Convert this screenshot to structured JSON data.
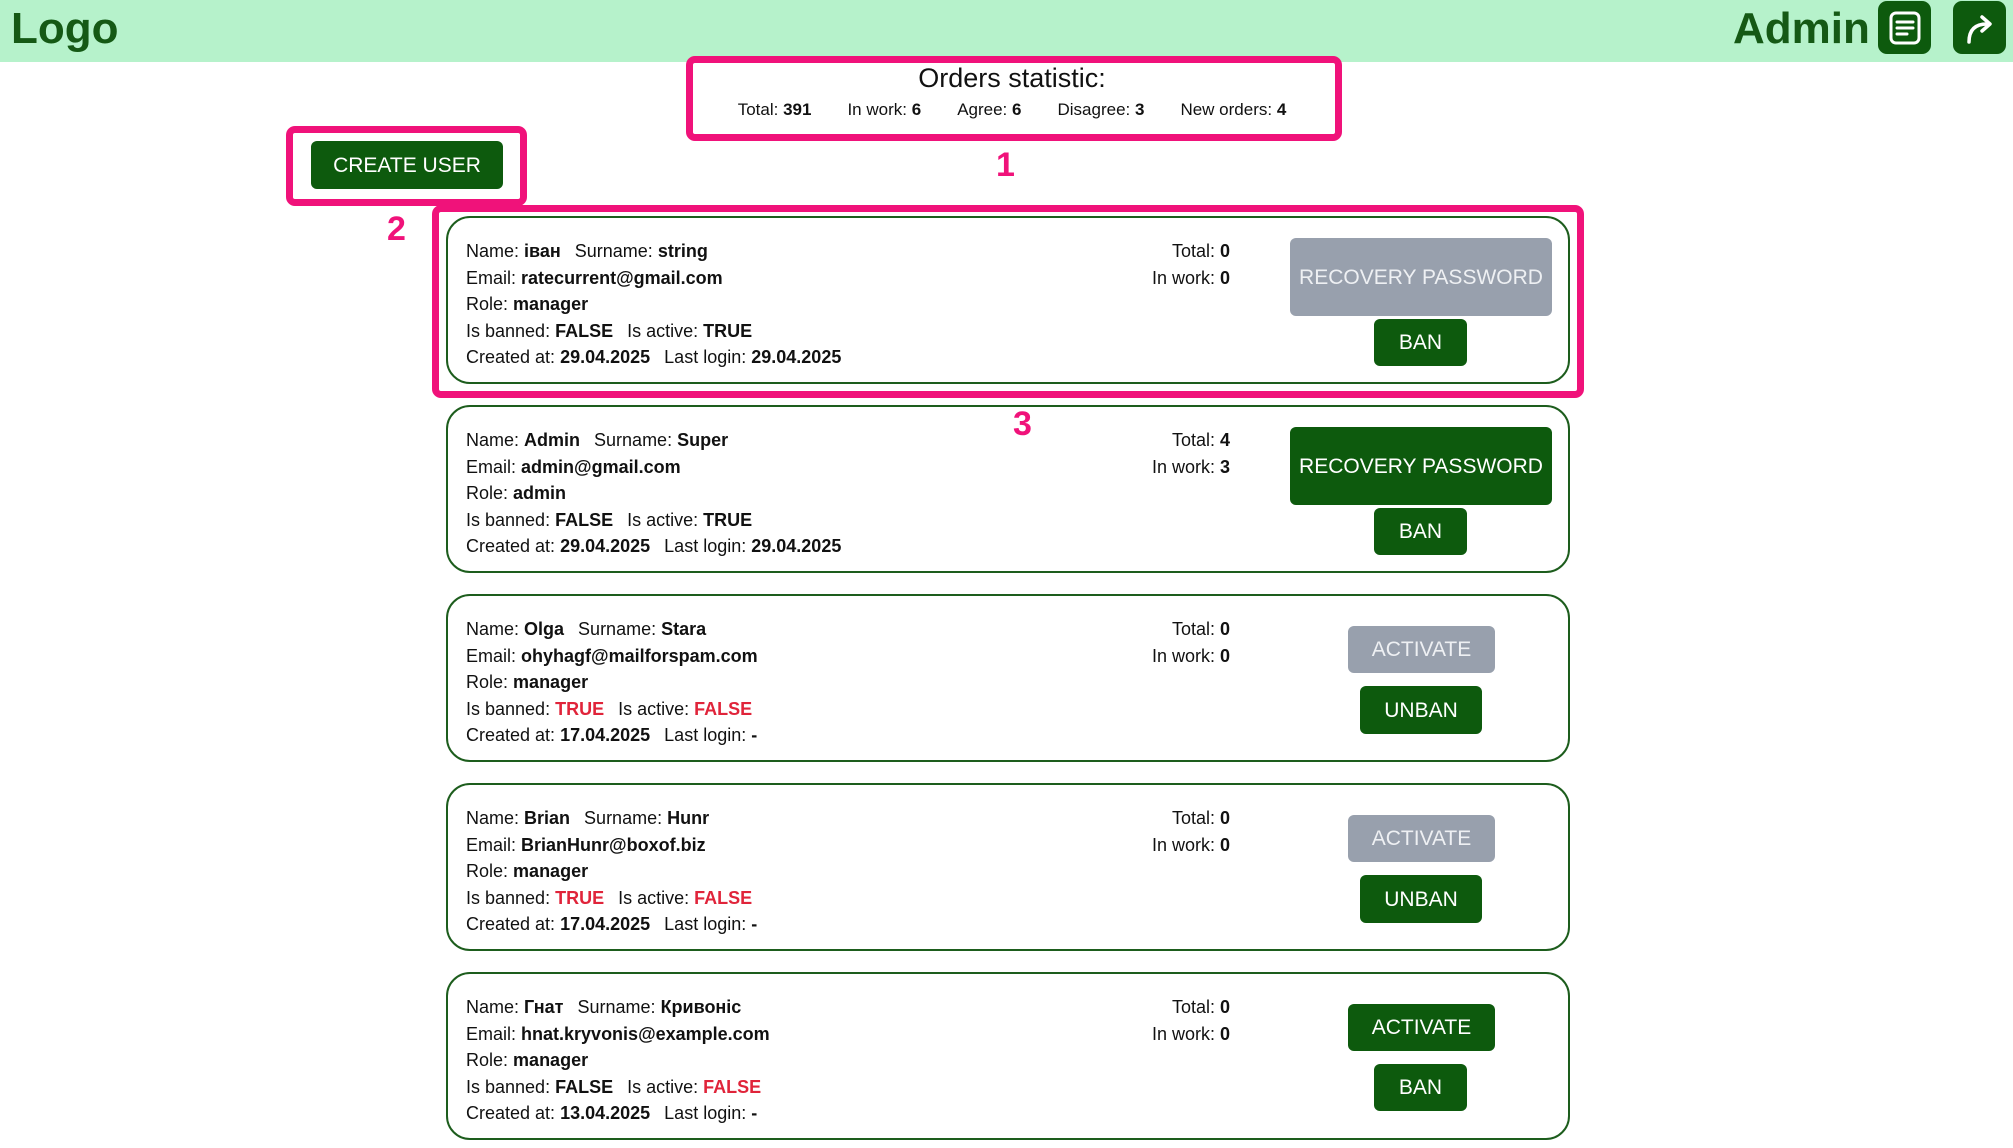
{
  "header": {
    "logo": "Logo",
    "user": "Admin",
    "orders_icon": "document-icon",
    "logout_icon": "share-arrow-icon",
    "bg_color": "#b6f2cb",
    "accent": "#0d5a0d"
  },
  "stats": {
    "title": "Orders statistic:",
    "items": [
      {
        "label": "Total:",
        "value": "391"
      },
      {
        "label": "In work:",
        "value": "6"
      },
      {
        "label": "Agree:",
        "value": "6"
      },
      {
        "label": "Disagree:",
        "value": "3"
      },
      {
        "label": "New orders:",
        "value": "4"
      }
    ]
  },
  "create_user_label": "CREATE USER",
  "annotations": [
    "1",
    "2",
    "3"
  ],
  "labels": {
    "name": "Name:",
    "surname": "Surname:",
    "email": "Email:",
    "role": "Role:",
    "banned": "Is banned:",
    "active": "Is active:",
    "created": "Created at:",
    "last_login": "Last login:",
    "total": "Total:",
    "in_work": "In work:"
  },
  "users": [
    {
      "name": "іван",
      "surname": "string",
      "email": "ratecurrent@gmail.com",
      "role": "manager",
      "banned": "FALSE",
      "active": "TRUE",
      "created": "29.04.2025",
      "last_login": "29.04.2025",
      "total": "0",
      "in_work": "0",
      "primary": "RECOVERY PASSWORD",
      "primary_disabled": true,
      "secondary": "BAN"
    },
    {
      "name": "Admin",
      "surname": "Super",
      "email": "admin@gmail.com",
      "role": "admin",
      "banned": "FALSE",
      "active": "TRUE",
      "created": "29.04.2025",
      "last_login": "29.04.2025",
      "total": "4",
      "in_work": "3",
      "primary": "RECOVERY PASSWORD",
      "primary_disabled": false,
      "secondary": "BAN"
    },
    {
      "name": "Olga",
      "surname": "Stara",
      "email": "ohyhagf@mailforspam.com",
      "role": "manager",
      "banned": "TRUE",
      "active": "FALSE",
      "created": "17.04.2025",
      "last_login": "-",
      "total": "0",
      "in_work": "0",
      "primary": "ACTIVATE",
      "primary_disabled": true,
      "secondary": "UNBAN"
    },
    {
      "name": "Brian",
      "surname": "Hunr",
      "email": "BrianHunr@boxof.biz",
      "role": "manager",
      "banned": "TRUE",
      "active": "FALSE",
      "created": "17.04.2025",
      "last_login": "-",
      "total": "0",
      "in_work": "0",
      "primary": "ACTIVATE",
      "primary_disabled": true,
      "secondary": "UNBAN"
    },
    {
      "name": "Гнат",
      "surname": "Кривоніс",
      "email": "hnat.kryvonis@example.com",
      "role": "manager",
      "banned": "FALSE",
      "active": "FALSE",
      "created": "13.04.2025",
      "last_login": "-",
      "total": "0",
      "in_work": "0",
      "primary": "ACTIVATE",
      "primary_disabled": false,
      "secondary": "BAN"
    }
  ]
}
